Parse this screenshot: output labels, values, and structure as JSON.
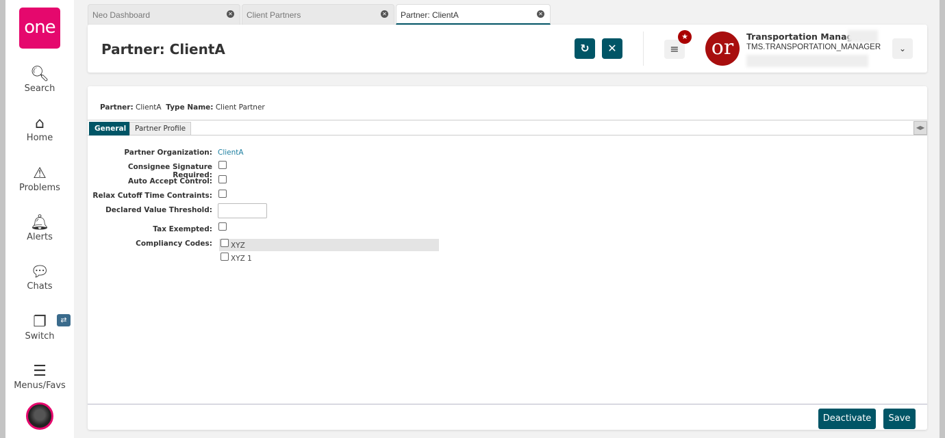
{
  "sidebar": {
    "logo": "one",
    "items": [
      {
        "label": "Search",
        "icon": "search-icon"
      },
      {
        "label": "Home",
        "icon": "home-icon"
      },
      {
        "label": "Problems",
        "icon": "warning-icon"
      },
      {
        "label": "Alerts",
        "icon": "bell-icon"
      },
      {
        "label": "Chats",
        "icon": "chat-icon"
      },
      {
        "label": "Switch",
        "icon": "switch-icon"
      },
      {
        "label": "Menus/Favs",
        "icon": "menu-icon"
      }
    ]
  },
  "tabs": [
    {
      "label": "Neo Dashboard"
    },
    {
      "label": "Client Partners"
    },
    {
      "label": "Partner: ClientA",
      "active": true
    }
  ],
  "header": {
    "title": "Partner: ClientA",
    "user_name": "Transportation Manager",
    "user_role": "TMS.TRANSPORTATION_MANAGER",
    "avatar_text": "or"
  },
  "meta": {
    "partner_label": "Partner:",
    "partner_value": "ClientA",
    "type_label": "Type Name:",
    "type_value": "Client Partner"
  },
  "subtabs": [
    "General",
    "Partner Profile"
  ],
  "form": {
    "partner_org_label": "Partner Organization:",
    "partner_org_value": "ClientA",
    "consignee_label": "Consignee Signature Required:",
    "auto_accept_label": "Auto Accept Control:",
    "relax_label": "Relax Cutoff Time Contraints:",
    "declared_label": "Declared Value Threshold:",
    "declared_value": "",
    "tax_label": "Tax Exempted:",
    "compliancy_label": "Compliancy Codes:",
    "compliancy_options": [
      "XYZ",
      "XYZ 1"
    ]
  },
  "footer": {
    "deactivate": "Deactivate",
    "save": "Save"
  },
  "colors": {
    "brand": "#e5086d",
    "primary": "#005566"
  }
}
